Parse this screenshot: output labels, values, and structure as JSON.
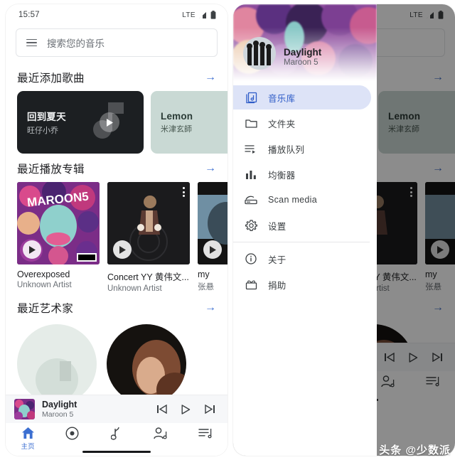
{
  "status_bar": {
    "time": "15:57",
    "network": "LTE"
  },
  "search": {
    "placeholder": "搜索您的音乐",
    "menu_icon": "hamburger-icon"
  },
  "sections": {
    "recent_songs": {
      "title": "最近添加歌曲",
      "arrow": "→"
    },
    "recent_albums": {
      "title": "最近播放专辑",
      "arrow": "→"
    },
    "recent_artists": {
      "title": "最近艺术家",
      "arrow": "→"
    }
  },
  "quick_cards": [
    {
      "title": "回到夏天",
      "artist": "旺仔小乔",
      "style": "dark"
    },
    {
      "title": "Lemon",
      "artist": "米津玄師",
      "style": "sage"
    }
  ],
  "albums": [
    {
      "title": "Overexposed",
      "artist": "Unknown Artist"
    },
    {
      "title": "Concert YY 黄伟文...",
      "artist": "Unknown Artist"
    },
    {
      "title": "my",
      "artist": "张悬"
    }
  ],
  "mini_player": {
    "title": "Daylight",
    "artist": "Maroon 5",
    "prev_label": "previous-track",
    "play_label": "play",
    "next_label": "next-track"
  },
  "bottom_nav": [
    {
      "label": "主页",
      "icon": "home-icon",
      "active": true
    },
    {
      "label": "",
      "icon": "disc-icon",
      "active": false
    },
    {
      "label": "",
      "icon": "music-note-icon",
      "active": false
    },
    {
      "label": "",
      "icon": "artist-icon",
      "active": false
    },
    {
      "label": "",
      "icon": "playlist-icon",
      "active": false
    }
  ],
  "drawer": {
    "header": {
      "title": "Daylight",
      "subtitle": "Maroon 5"
    },
    "items": [
      {
        "label": "音乐库",
        "icon": "library-icon",
        "active": true
      },
      {
        "label": "文件夹",
        "icon": "folder-icon",
        "active": false
      },
      {
        "label": "播放队列",
        "icon": "queue-icon",
        "active": false
      },
      {
        "label": "均衡器",
        "icon": "equalizer-icon",
        "active": false
      },
      {
        "label": "Scan media",
        "icon": "scanner-icon",
        "active": false
      },
      {
        "label": "设置",
        "icon": "gear-icon",
        "active": false
      }
    ],
    "items_secondary": [
      {
        "label": "关于",
        "icon": "info-icon",
        "active": false
      },
      {
        "label": "捐助",
        "icon": "donate-icon",
        "active": false
      }
    ]
  },
  "watermark": {
    "text": "头条 @少数派"
  },
  "colors": {
    "accent": "#3c6fd1",
    "drawer_selected_bg": "#dde3f7",
    "drawer_selected_fg": "#2d5bc7",
    "card_dark": "#1c1f22",
    "card_sage": "#c9d9d4"
  }
}
